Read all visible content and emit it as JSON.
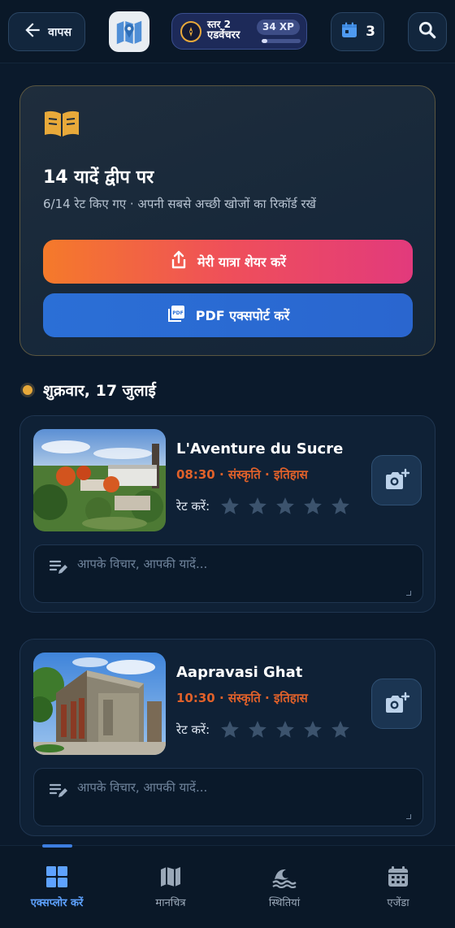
{
  "header": {
    "back_label": "वापस",
    "level_line1": "स्तर 2",
    "level_line2": "एडवेंचरर",
    "xp_label": "34 XP",
    "xp_progress": 0.15,
    "calendar_count": "3"
  },
  "memories": {
    "title": "14 यादें द्वीप पर",
    "subtitle": "6/14 रेट किए गए · अपनी सबसे अच्छी खोजों का रिकॉर्ड रखें",
    "share_label": "मेरी यात्रा शेयर करें",
    "pdf_label": "PDF एक्सपोर्ट करें"
  },
  "day": {
    "title": "शुक्रवार, 17 जुलाई"
  },
  "activities": [
    {
      "title": "L'Aventure du Sucre",
      "meta": "08:30 · संस्कृति · इतिहास",
      "rate_label": "रेट करें:",
      "rating": 0,
      "note_placeholder": "आपके विचार, आपकी यादें..."
    },
    {
      "title": "Aapravasi Ghat",
      "meta": "10:30 · संस्कृति · इतिहास",
      "rate_label": "रेट करें:",
      "rating": 0,
      "note_placeholder": "आपके विचार, आपकी यादें..."
    }
  ],
  "nav": {
    "items": [
      {
        "label": "एक्सप्लोर करें",
        "icon": "grid-icon",
        "active": true
      },
      {
        "label": "मानचित्र",
        "icon": "map-icon",
        "active": false
      },
      {
        "label": "स्थितियां",
        "icon": "wave-icon",
        "active": false
      },
      {
        "label": "एजेंडा",
        "icon": "calendar-icon",
        "active": false
      }
    ]
  },
  "colors": {
    "background": "#0b1a2c",
    "accent_orange": "#e0612a",
    "accent_blue": "#5ea2ff",
    "gold": "#e8a93a"
  }
}
